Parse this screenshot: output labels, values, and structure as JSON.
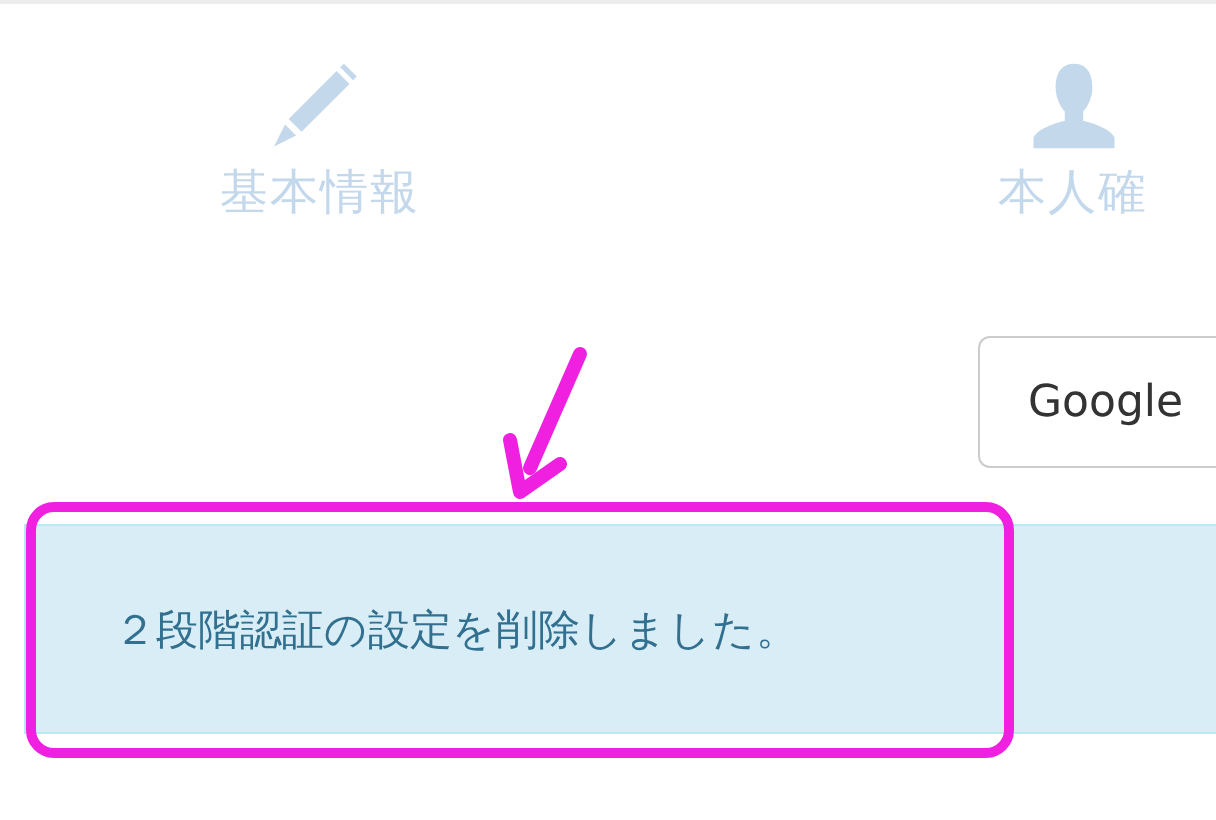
{
  "steps": [
    {
      "kind": "pencil",
      "label": "基本情報"
    },
    {
      "kind": "person",
      "label": "本人確"
    }
  ],
  "google_button": {
    "label": "Google"
  },
  "alert": {
    "message": "２段階認証の設定を削除しました。"
  }
}
